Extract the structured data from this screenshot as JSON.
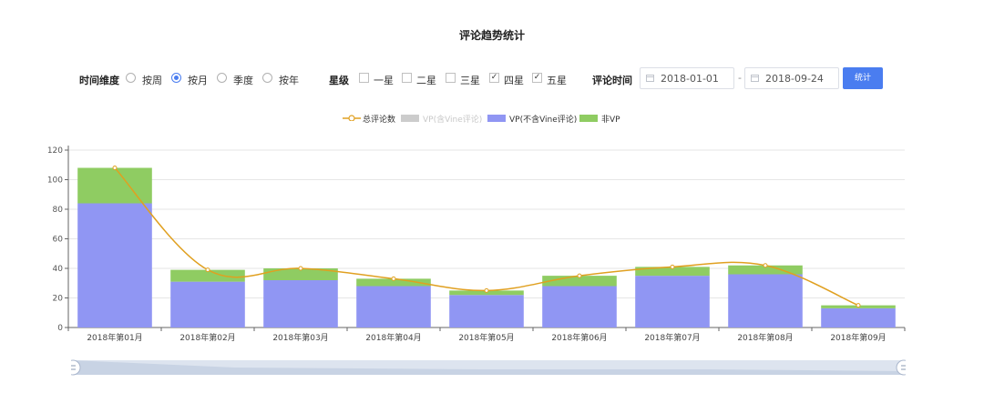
{
  "title": "评论趋势统计",
  "filters": {
    "time_dim_label": "时间维度",
    "time_options": [
      {
        "label": "按周",
        "checked": false
      },
      {
        "label": "按月",
        "checked": true
      },
      {
        "label": "季度",
        "checked": false
      },
      {
        "label": "按年",
        "checked": false
      }
    ],
    "star_label": "星级",
    "star_options": [
      {
        "label": "一星",
        "checked": false
      },
      {
        "label": "二星",
        "checked": false
      },
      {
        "label": "三星",
        "checked": false
      },
      {
        "label": "四星",
        "checked": true
      },
      {
        "label": "五星",
        "checked": true
      }
    ],
    "review_time_label": "评论时间",
    "date_start": "2018-01-01",
    "date_sep": "-",
    "date_end": "2018-09-24",
    "submit_label": "统计"
  },
  "colors": {
    "total_line": "#e0a020",
    "vine": "#cccccc",
    "vp": "#9096f3",
    "non_vp": "#8fcc62",
    "accent": "#4a7df0"
  },
  "chart_data": {
    "type": "bar",
    "categories": [
      "2018年第01月",
      "2018年第02月",
      "2018年第03月",
      "2018年第04月",
      "2018年第05月",
      "2018年第06月",
      "2018年第07月",
      "2018年第08月",
      "2018年第09月"
    ],
    "series": [
      {
        "name": "总评论数",
        "kind": "line",
        "values": [
          108,
          39,
          40,
          33,
          25,
          35,
          41,
          42,
          15
        ]
      },
      {
        "name": "VP(含Vine评论)",
        "kind": "bar",
        "hidden": true,
        "values": []
      },
      {
        "name": "VP(不含Vine评论)",
        "kind": "bar",
        "values": [
          84,
          31,
          32,
          28,
          22,
          28,
          35,
          36,
          13
        ]
      },
      {
        "name": "非VP",
        "kind": "bar",
        "values": [
          24,
          8,
          8,
          5,
          3,
          7,
          6,
          6,
          2
        ]
      }
    ],
    "stacked": true,
    "ylim": [
      0,
      120
    ],
    "yticks": [
      "0",
      "20",
      "40",
      "60",
      "80",
      "100",
      "120"
    ],
    "grid": true,
    "legend": "top-center"
  }
}
